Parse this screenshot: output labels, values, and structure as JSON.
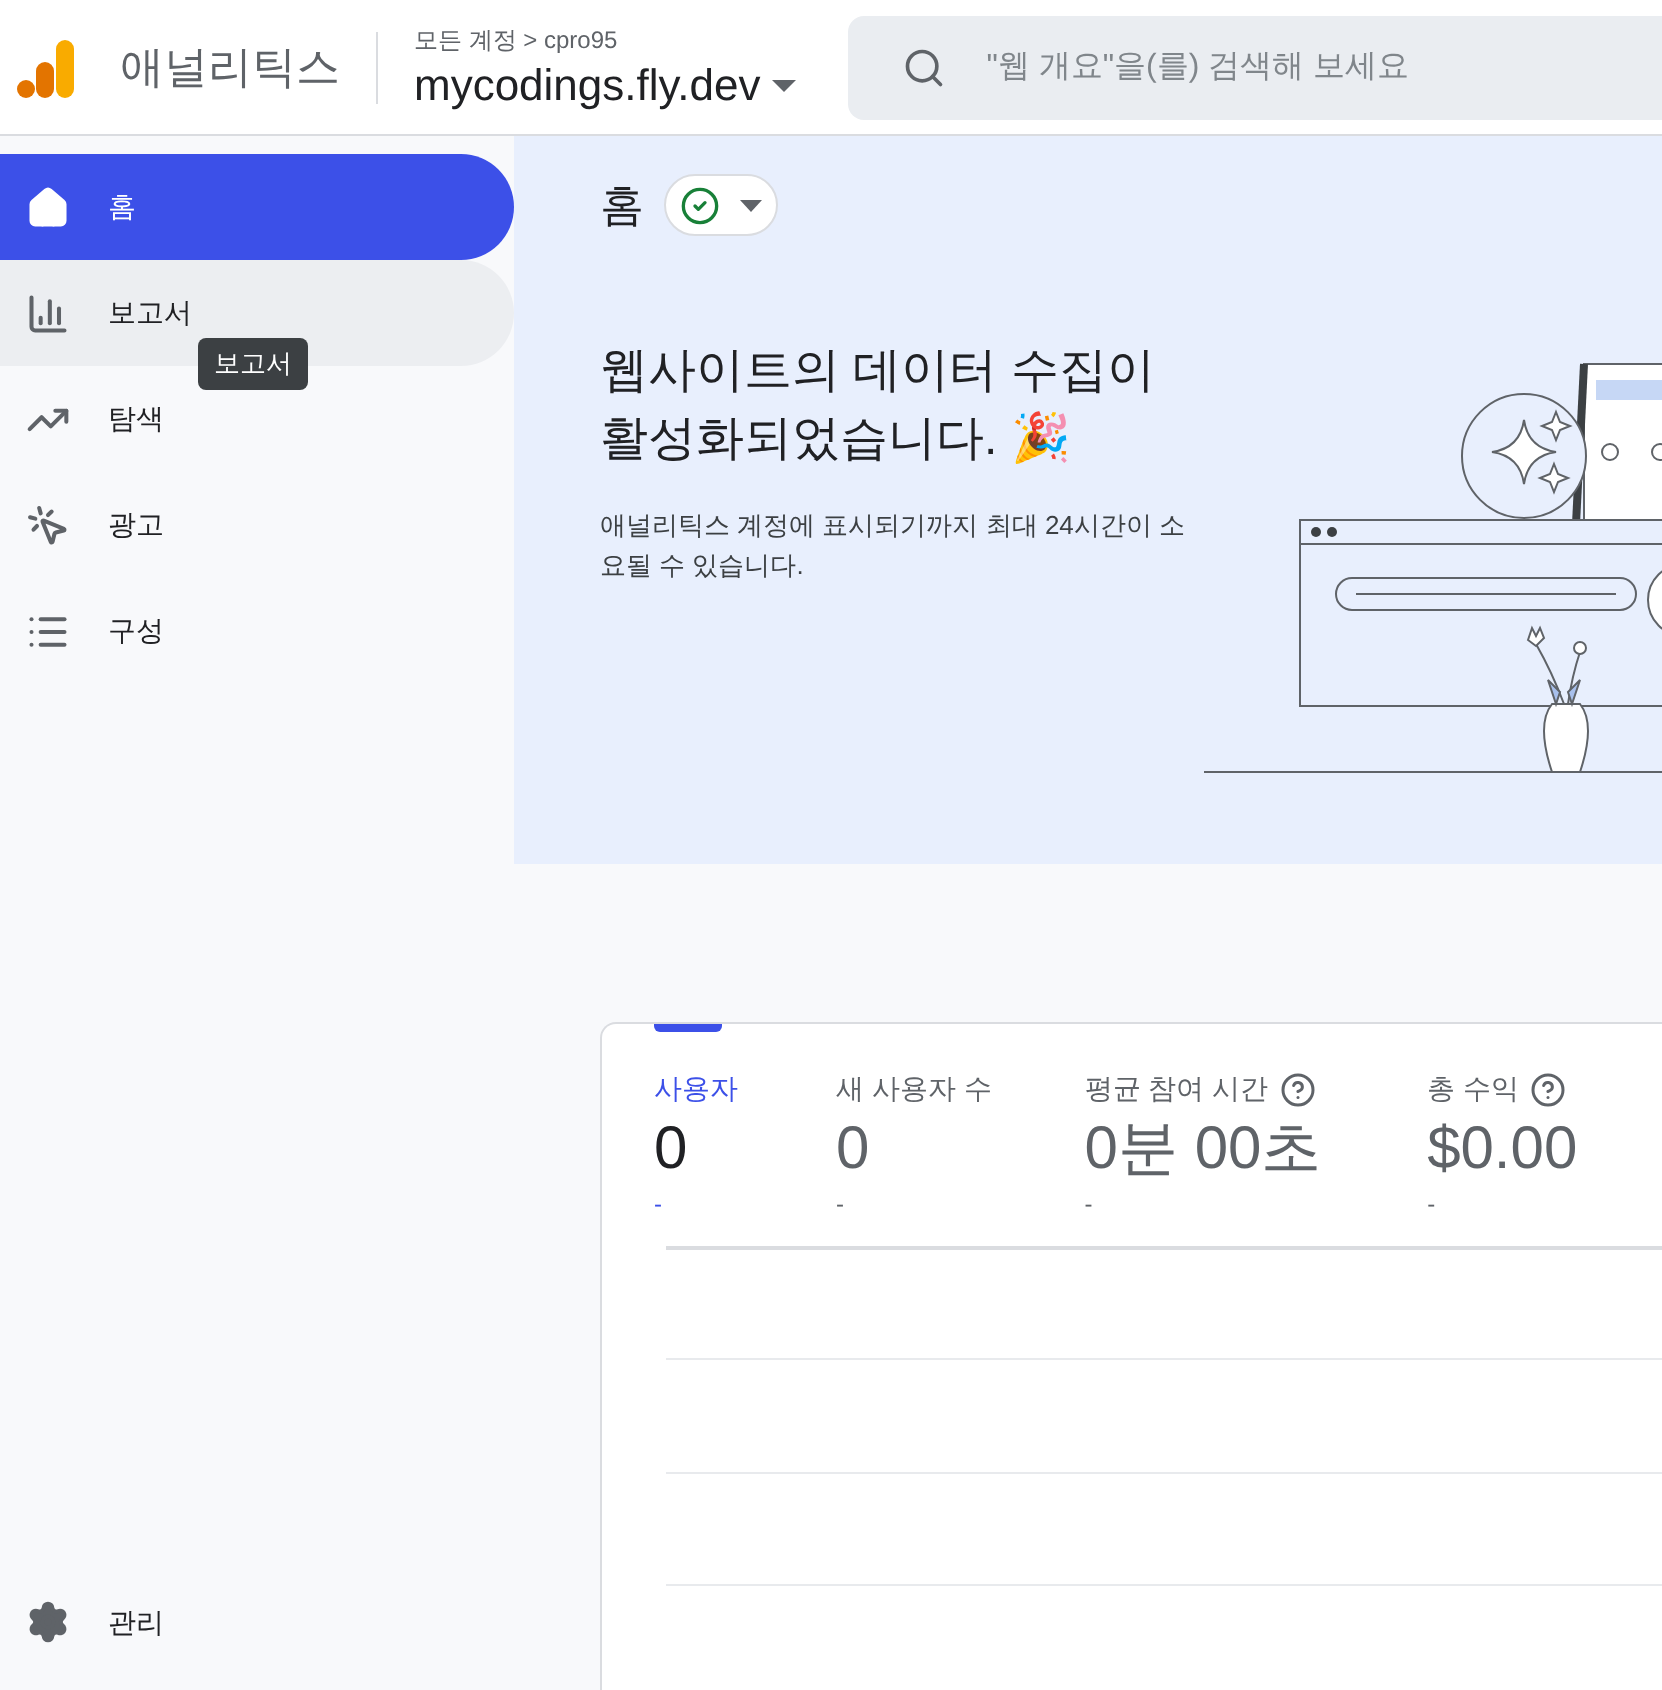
{
  "header": {
    "product": "애널리틱스",
    "breadcrumb": "모든 계정 > cpro95",
    "property": "mycodings.fly.dev",
    "search": {
      "placeholder": "\"웹 개요\"을(를) 검색해 보세요"
    }
  },
  "sidebar": {
    "items": [
      {
        "kind": "home",
        "label": "홈",
        "selected": true,
        "hovered": false
      },
      {
        "kind": "reports",
        "label": "보고서",
        "selected": false,
        "hovered": true
      },
      {
        "kind": "explore",
        "label": "탐색",
        "selected": false,
        "hovered": false
      },
      {
        "kind": "ads",
        "label": "광고",
        "selected": false,
        "hovered": false
      },
      {
        "kind": "configure",
        "label": "구성",
        "selected": false,
        "hovered": false
      }
    ],
    "tooltip": "보고서",
    "admin": {
      "kind": "admin",
      "label": "관리"
    }
  },
  "page": {
    "title": "홈",
    "banner": {
      "heading": "웹사이트의 데이터 수집이 활성화되었습니다. 🎉",
      "body": "애널리틱스 계정에 표시되기까지 최대 24시간이 소요될 수 있습니다."
    }
  },
  "metrics": [
    {
      "label": "사용자",
      "value": "0",
      "change": "-",
      "selected": true,
      "help": false
    },
    {
      "label": "새 사용자 수",
      "value": "0",
      "change": "-",
      "selected": false,
      "help": false
    },
    {
      "label": "평균 참여 시간",
      "value": "0분 00초",
      "change": "-",
      "selected": false,
      "help": true
    },
    {
      "label": "총 수익",
      "value": "$0.00",
      "change": "-",
      "selected": false,
      "help": true
    }
  ]
}
